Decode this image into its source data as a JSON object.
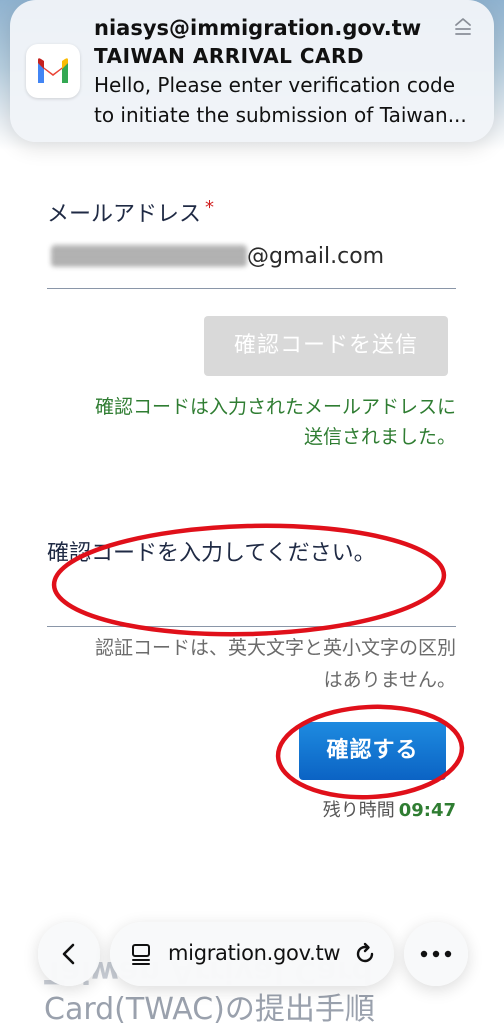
{
  "notification": {
    "app_icon": "gmail-icon",
    "sender": "niasys@immigration.gov.tw",
    "subject": "TAIWAN ARRIVAL CARD",
    "body_line1": "Hello, Please enter verification code",
    "body_line2": "to initiate the submission of Taiwan...",
    "collapse_icon": "collapse-icon"
  },
  "form": {
    "email_label": "メールアドレス",
    "required_mark": "*",
    "email_domain": "@gmail.com",
    "send_code_label": "確認コードを送信",
    "sent_message_line1": "確認コードは入力されたメールアドレスに",
    "sent_message_line2": "送信されました。",
    "code_label": "確認コードを入力してください。",
    "code_value": "",
    "case_note_line1": "認証コードは、英大文字と英小文字の区別",
    "case_note_line2": "はありません。",
    "confirm_label": "確認する",
    "remaining_label": "残り時間",
    "remaining_time": "09:47"
  },
  "background": {
    "line1": "Taiwan Arrival Card",
    "line2": "Card(TWAC)の提出手順"
  },
  "browser": {
    "url": "migration.gov.tw",
    "back_icon": "chevron-left-icon",
    "tabs_icon": "tabs-icon",
    "reload_icon": "reload-icon",
    "more_icon": "more-icon"
  },
  "colors": {
    "accent_blue": "#0b63c4",
    "success_green": "#2f7d32",
    "required_red": "#d12020",
    "annotation_red": "#e0101a"
  }
}
